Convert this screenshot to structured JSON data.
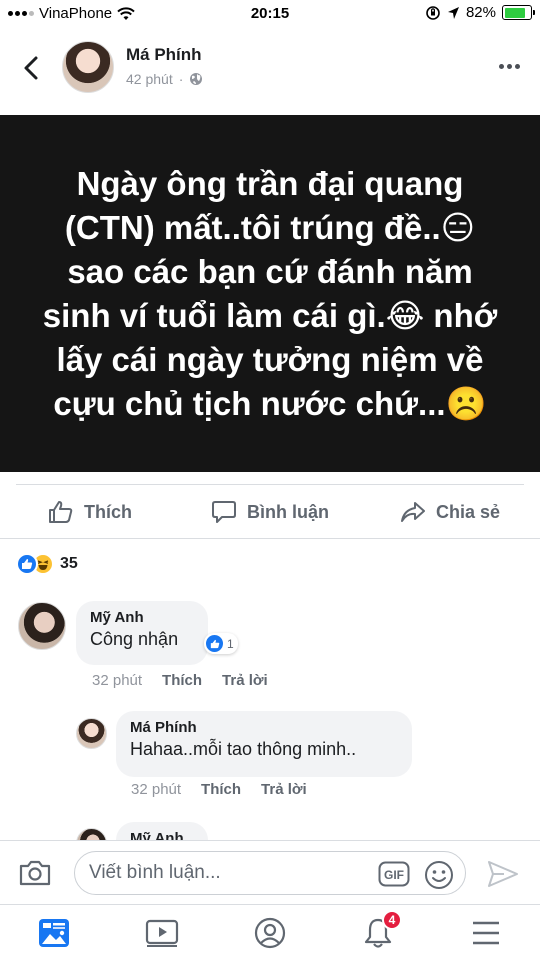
{
  "status_bar": {
    "carrier": "VinaPhone",
    "time": "20:15",
    "battery": "82%",
    "battery_level": 0.82
  },
  "post": {
    "author": "Má Phính",
    "time": "42 phút",
    "text": "Ngày ông trần đại quang\n(CTN) mất..tôi trúng đề..😑\nsao các bạn cứ đánh năm\nsinh ví tuổi làm cái gì.😂 nhớ\nlấy cái ngày tưởng niệm về\ncựu chủ tịch nước chứ...☹️",
    "background": "#151515"
  },
  "actions": {
    "like": "Thích",
    "comment": "Bình luận",
    "share": "Chia sẻ"
  },
  "reactions": {
    "count": "35"
  },
  "comments": [
    {
      "name": "Mỹ Anh",
      "text": "Công nhận",
      "reaction_count": "1",
      "time": "32 phút",
      "like": "Thích",
      "reply": "Trả lời"
    },
    {
      "name": "Má Phính",
      "text": "Hahaa..mỗi tao thông minh..",
      "time": "32 phút",
      "like": "Thích",
      "reply": "Trả lời"
    },
    {
      "name": "Mỹ Anh"
    }
  ],
  "composer": {
    "placeholder": "Viết bình luận...",
    "gif": "GIF"
  },
  "bottom_nav": {
    "notifications_badge": "4"
  },
  "colors": {
    "accent": "#1877f2",
    "badge": "#e41e3f"
  }
}
